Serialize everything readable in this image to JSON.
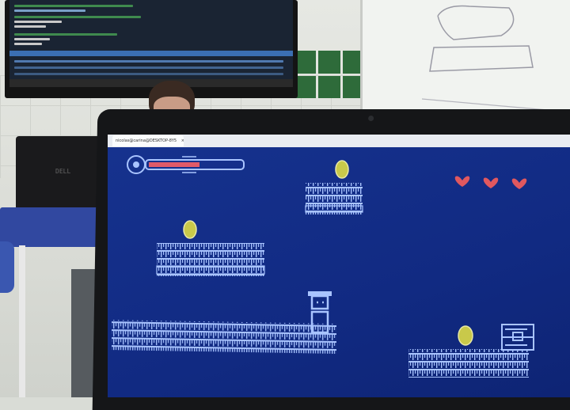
{
  "terminal_tab": {
    "title": "nicolas@carina@DESKTOP-8Y5",
    "close_glyph": "×"
  },
  "game": {
    "health_fill": 0.55,
    "lives": 3,
    "colors": {
      "background": "#12298a",
      "ascii": "#a9c4ff",
      "coin": "#c9c94a",
      "heart": "#e0585f",
      "health": "#e05a68"
    }
  }
}
